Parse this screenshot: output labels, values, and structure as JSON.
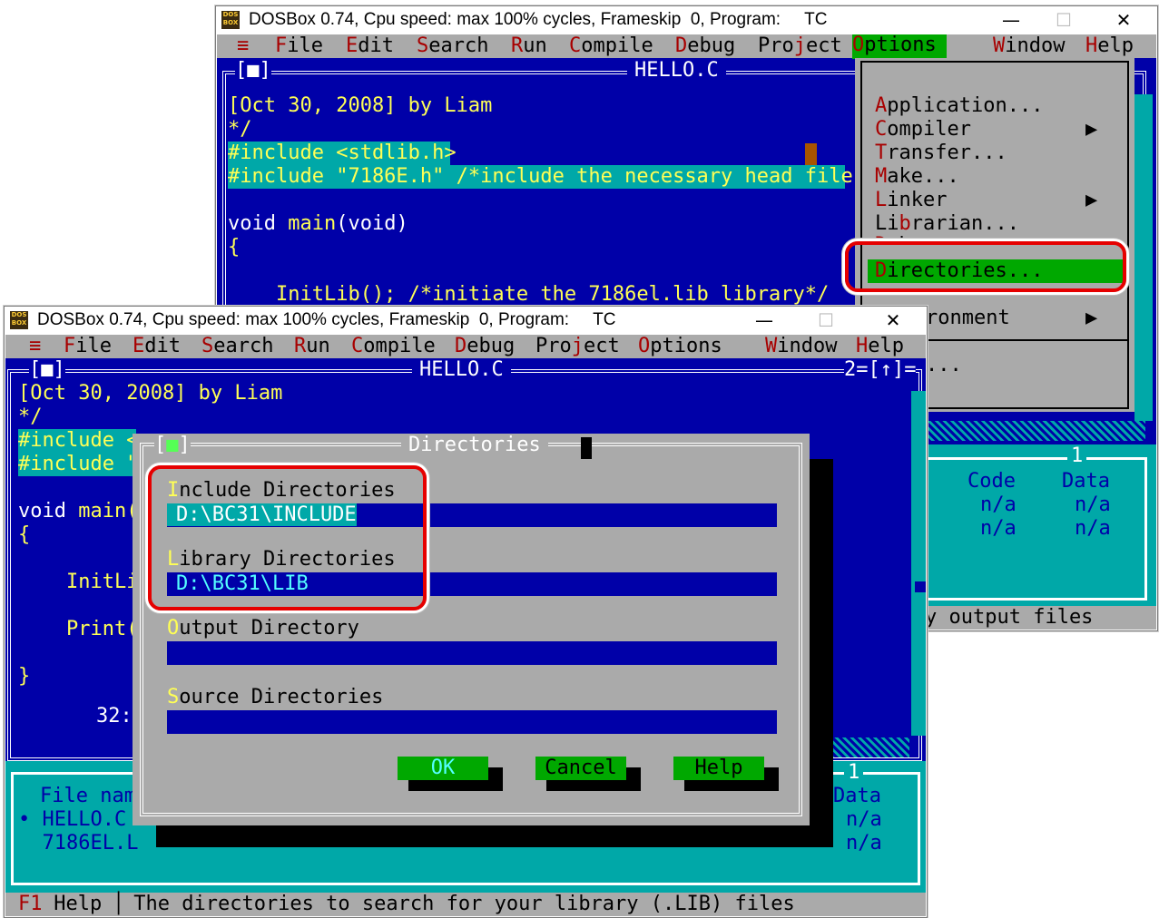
{
  "back_window": {
    "title": "DOSBox 0.74, Cpu speed: max 100% cycles, Frameskip  0, Program:     TC",
    "icon": "dosbox-icon",
    "menu": [
      {
        "hot": "F",
        "rest": "ile"
      },
      {
        "hot": "E",
        "rest": "dit"
      },
      {
        "hot": "S",
        "rest": "earch"
      },
      {
        "hot": "R",
        "rest": "un"
      },
      {
        "hot": "C",
        "rest": "ompile"
      },
      {
        "hot": "D",
        "rest": "ebug"
      },
      {
        "pre": "Pro",
        "hot": "j",
        "rest": "ect"
      },
      {
        "hot": "O",
        "rest": "ptions"
      },
      {
        "hot": "W",
        "rest": "indow"
      },
      {
        "hot": "H",
        "rest": "elp"
      }
    ],
    "system_menu": "≡",
    "editor_title": "HELLO.C",
    "editor_close": "[■]",
    "code": [
      "[Oct 30, 2008] by Liam",
      "*/",
      "#include <stdlib.h>",
      "#include \"7186E.h\" /*include the necessary head file",
      "",
      "void main(void)",
      "{",
      "",
      "    InitLib(); /*initiate the 7186el.lib library*/"
    ],
    "options_menu": [
      {
        "hot": "A",
        "rest": "pplication...",
        "arrow": false
      },
      {
        "hot": "C",
        "rest": "ompiler",
        "arrow": true
      },
      {
        "hot": "T",
        "rest": "ransfer...",
        "arrow": false
      },
      {
        "hot": "M",
        "rest": "ake...",
        "arrow": false
      },
      {
        "hot": "L",
        "rest": "inker",
        "arrow": true
      },
      {
        "pre": "Li",
        "hot": "b",
        "rest": "rarian...",
        "arrow": false
      },
      {
        "pre": "",
        "hot": "D",
        "rest": "ebugger",
        "arrow": false
      },
      {
        "hot": "D",
        "rest": "irectories...",
        "arrow": false
      },
      {
        "hot": "E",
        "rest": "nvironment",
        "arrow": true
      }
    ],
    "env_visible": "ronment",
    "more_dots": "...",
    "right_panel": {
      "number": "1",
      "col1": "Code",
      "col2": "Data",
      "row1": [
        "n/a",
        "n/a"
      ],
      "row2": [
        "n/a",
        "n/a"
      ]
    },
    "status_fragment": "y output files"
  },
  "front_window": {
    "title": "DOSBox 0.74, Cpu speed: max 100% cycles, Frameskip  0, Program:     TC",
    "editor_title": "HELLO.C",
    "editor_number": "2=[↑]=",
    "editor_close": "[■]",
    "code_lines": [
      "[Oct 30, 2008] by Liam",
      "*/",
      "#include <",
      "#include \"",
      "",
      "void main(",
      "{",
      "",
      "    InitLi",
      "",
      "    Print(",
      "",
      "}"
    ],
    "line_col": "32:",
    "messages": {
      "number": "1",
      "col_file": "File nam",
      "files": [
        "• HELLO.C",
        "  7186EL.L"
      ],
      "col_data": "Data",
      "data": [
        "n/a",
        "n/a"
      ]
    },
    "dialog": {
      "title": "Directories",
      "close": "[■]",
      "include_label_hot": "I",
      "include_label": "nclude Directories",
      "include_value": "D:\\BC31\\INCLUDE",
      "library_label_hot": "L",
      "library_label": "ibrary Directories",
      "library_value": "D:\\BC31\\LIB",
      "output_label_hot": "O",
      "output_label": "utput Directory",
      "output_value": "",
      "source_label_hot": "S",
      "source_label": "ource Directories",
      "source_value": "",
      "ok": "OK",
      "cancel": "Cancel",
      "help": "Help"
    },
    "status": {
      "key": "F1",
      "key_label": " Help ",
      "sep": "│",
      "hint": " The directories to search for your library (.LIB) files"
    }
  },
  "colors": {
    "dos_blue": "#0000a8",
    "dos_gray": "#aaaaaa",
    "dos_cyan": "#00a8a8",
    "highlight_green": "#00a800",
    "callout_red": "#e60000"
  }
}
